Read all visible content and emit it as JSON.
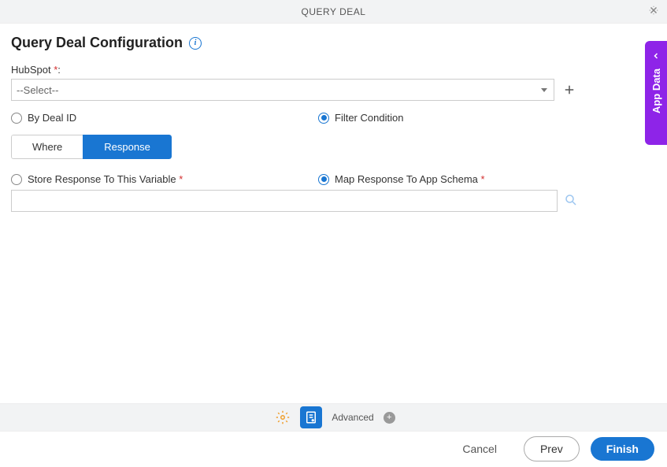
{
  "header": {
    "title": "QUERY DEAL"
  },
  "page": {
    "title": "Query Deal Configuration"
  },
  "hubspot": {
    "label": "HubSpot",
    "required": "*",
    "colon": ":",
    "placeholder": "--Select--"
  },
  "query_mode": {
    "by_deal_id": "By Deal ID",
    "filter_condition": "Filter Condition"
  },
  "tabs": {
    "where": "Where",
    "response": "Response"
  },
  "response_mode": {
    "store_variable": "Store Response To This Variable",
    "map_schema": "Map Response To App Schema",
    "required": "*"
  },
  "response_input": {
    "value": ""
  },
  "side_panel": {
    "label": "App Data"
  },
  "bottom_toolbar": {
    "advanced": "Advanced"
  },
  "footer": {
    "cancel": "Cancel",
    "prev": "Prev",
    "finish": "Finish"
  }
}
